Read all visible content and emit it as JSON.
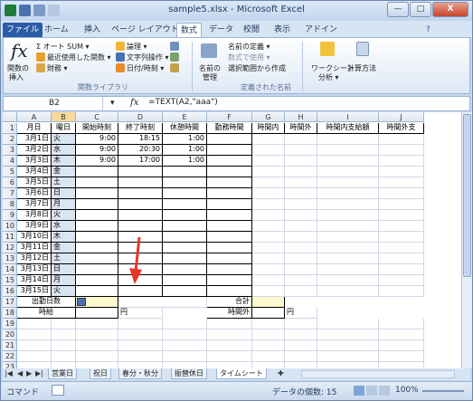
{
  "window": {
    "title": "sample5.xlsx - Microsoft Excel",
    "buttons": {
      "minimize": "—",
      "maximize": "□",
      "close": "X"
    }
  },
  "ribbon_tabs": [
    "ファイル",
    "ホーム",
    "挿入",
    "ページ レイアウト",
    "数式",
    "データ",
    "校閲",
    "表示",
    "アドイン"
  ],
  "ribbon": {
    "fx_label": "fx",
    "insert_function": [
      "関数の",
      "挿入"
    ],
    "autosum": "Σ オート SUM ▾",
    "recent": "最近使用した関数 ▾",
    "financial": "財務 ▾",
    "logical": "論理 ▾",
    "text": "文字列操作 ▾",
    "datetime": "日付/時刻 ▾",
    "library_label": "関数ライブラリ",
    "name_manager": [
      "名前の",
      "管理"
    ],
    "define_name": "名前の定義 ▾",
    "use_in_formula": "数式で使用 ▾",
    "create_from_selection": "選択範囲から作成",
    "names_label": "定義された名前",
    "watch_window": [
      "ウォッチ",
      "ウィンドウ"
    ],
    "watch_label": "ワークシート",
    "watch_sub": "分析 ▾",
    "calc_options": "計算方法"
  },
  "formula_bar": {
    "name_box": "B2",
    "fx": "fx",
    "formula": "=TEXT(A2,\"aaa\")"
  },
  "columns": [
    "A",
    "B",
    "C",
    "D",
    "E",
    "F",
    "G",
    "H",
    "I",
    "J"
  ],
  "header_row": [
    "月日",
    "曜日",
    "開始時刻",
    "終了時刻",
    "休憩時間",
    "勤務時間",
    "時間内",
    "時間外",
    "時間内支給額",
    "時間外支"
  ],
  "rows": [
    [
      "3月1日",
      "火",
      "9:00",
      "18:15",
      "1:00"
    ],
    [
      "3月2日",
      "水",
      "9:00",
      "20:30",
      "1:00"
    ],
    [
      "3月3日",
      "木",
      "9:00",
      "17:00",
      "1:00"
    ],
    [
      "3月4日",
      "金",
      "",
      "",
      ""
    ],
    [
      "3月5日",
      "土",
      "",
      "",
      ""
    ],
    [
      "3月6日",
      "日",
      "",
      "",
      ""
    ],
    [
      "3月7日",
      "月",
      "",
      "",
      ""
    ],
    [
      "3月8日",
      "火",
      "",
      "",
      ""
    ],
    [
      "3月9日",
      "水",
      "",
      "",
      ""
    ],
    [
      "3月10日",
      "木",
      "",
      "",
      ""
    ],
    [
      "3月11日",
      "金",
      "",
      "",
      ""
    ],
    [
      "3月12日",
      "土",
      "",
      "",
      ""
    ],
    [
      "3月13日",
      "日",
      "",
      "",
      ""
    ],
    [
      "3月14日",
      "月",
      "",
      "",
      ""
    ],
    [
      "3月15日",
      "火",
      "",
      "",
      ""
    ]
  ],
  "summary": {
    "workdays": "出勤日数",
    "hourly": "時給",
    "yen": "円",
    "total": "合計",
    "overtime": "時間外",
    "yen2": "円"
  },
  "row_numbers": [
    "1",
    "2",
    "3",
    "4",
    "5",
    "6",
    "7",
    "8",
    "9",
    "10",
    "11",
    "12",
    "13",
    "14",
    "15",
    "16",
    "17",
    "18",
    "19",
    "20",
    "21",
    "22",
    "23"
  ],
  "sheet_tabs": [
    "営業日",
    "祝日",
    "春分・秋分",
    "振替休日",
    "タイムシート"
  ],
  "status": {
    "mode": "コマンド",
    "count": "データの個数: 15",
    "zoom": "100%"
  },
  "colors": {
    "accent": "#2a5ca8",
    "selection": "#dbe5f1",
    "arrow": "#e8352a"
  }
}
